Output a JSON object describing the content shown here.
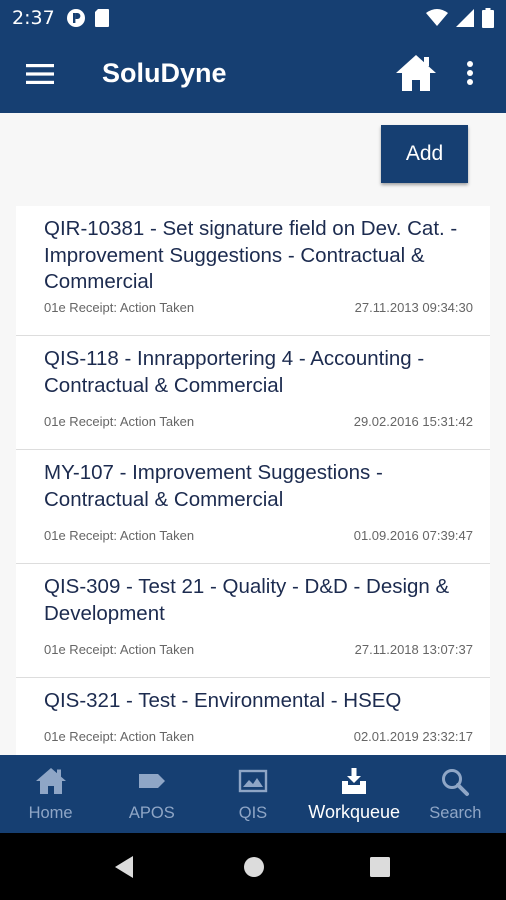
{
  "status_bar": {
    "time": "2:37"
  },
  "app_bar": {
    "title": "SoluDyne"
  },
  "actions": {
    "add_label": "Add"
  },
  "workqueue_items": [
    {
      "title": "QIR-10381 - Set signature field on Dev. Cat. - Improvement Suggestions - Contractual & Commercial",
      "status": "01e Receipt: Action Taken",
      "date": "27.11.2013 09:34:30"
    },
    {
      "title": "QIS-118 - Innrapportering 4 - Accounting - Contractual & Commercial",
      "status": "01e Receipt: Action Taken",
      "date": "29.02.2016 15:31:42"
    },
    {
      "title": "MY-107 - Improvement Suggestions - Contractual & Commercial",
      "status": "01e Receipt: Action Taken",
      "date": "01.09.2016 07:39:47"
    },
    {
      "title": "QIS-309 - Test 21 - Quality - D&D - Design & Development",
      "status": "01e Receipt: Action Taken",
      "date": "27.11.2018 13:07:37"
    },
    {
      "title": "QIS-321 - Test - Environmental - HSEQ",
      "status": "01e Receipt: Action Taken",
      "date": "02.01.2019 23:32:17"
    }
  ],
  "bottom_nav": {
    "items": [
      {
        "label": "Home",
        "icon": "home-icon",
        "active": false
      },
      {
        "label": "APOS",
        "icon": "tag-icon",
        "active": false
      },
      {
        "label": "QIS",
        "icon": "image-icon",
        "active": false
      },
      {
        "label": "Workqueue",
        "icon": "inbox-download-icon",
        "active": true
      },
      {
        "label": "Search",
        "icon": "search-icon",
        "active": false
      }
    ]
  },
  "colors": {
    "primary": "#163f72",
    "nav_inactive": "#8fa6c6",
    "item_title": "#1c2b4f"
  }
}
